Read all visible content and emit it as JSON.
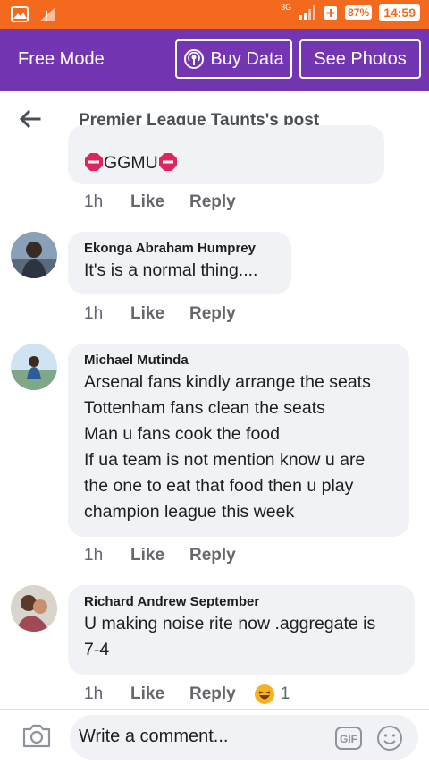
{
  "status_bar": {
    "network": "3G",
    "battery": "87%",
    "time": "14:59"
  },
  "top_bar": {
    "mode": "Free Mode",
    "buy_data": "Buy Data",
    "see_photos": "See Photos"
  },
  "header": {
    "title": "Premier League Taunts's post"
  },
  "comments": [
    {
      "name": "",
      "text": "GGMU",
      "time": "1h",
      "like": "Like",
      "reply": "Reply"
    },
    {
      "name": "Ekonga Abraham Humprey",
      "lines": [
        "It's is a normal thing...."
      ],
      "time": "1h",
      "like": "Like",
      "reply": "Reply"
    },
    {
      "name": "Michael Mutinda",
      "lines": [
        "Arsenal fans kindly arrange the seats",
        "Tottenham fans clean the seats",
        "Man u fans cook the food",
        "If ua team is not mention know u are",
        "the one to eat that food then u play",
        "champion league this week"
      ],
      "time": "1h",
      "like": "Like",
      "reply": "Reply"
    },
    {
      "name": "Richard Andrew September",
      "lines": [
        "U making noise rite now .aggregate is",
        "7-4"
      ],
      "time": "1h",
      "like": "Like",
      "reply": "Reply",
      "reaction_icon": "laughing-emoji-icon",
      "reaction_count": "1"
    }
  ],
  "composer": {
    "placeholder": "Write a comment...",
    "gif_label": "GIF"
  },
  "colors": {
    "status": "#f36a1e",
    "free_bar": "#7435b3",
    "bubble": "#f0f2f5"
  }
}
